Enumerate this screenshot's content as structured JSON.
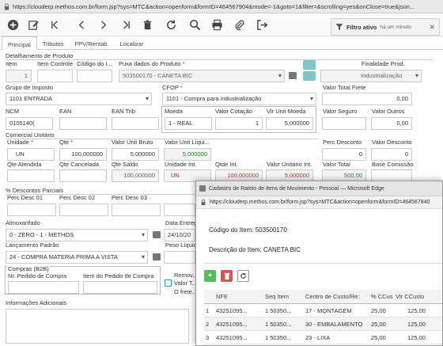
{
  "browser": {
    "url": "https://clouderp.methos.com.br/form.jsp?sys=MTC&action=openform&formID=464567904&mode=-1&goto=1&filter=&scrolling=yes&onClose=true&json..."
  },
  "toolbar": {
    "icons": [
      "add-icon",
      "edit-icon",
      "back-icon",
      "prev-icon",
      "next-icon",
      "forward-icon",
      "delete-icon",
      "refresh-icon",
      "search-icon",
      "print-icon",
      "attach-icon",
      "exit-icon"
    ],
    "filter_label": "Filtro ativo",
    "filter_time": "há um minuto"
  },
  "tabs": [
    "Principal",
    "Tributos",
    "FPV/Rentab.",
    "Localizar"
  ],
  "form": {
    "section_detalhamento": "Detalhamento de Produto",
    "item_label": "Item",
    "item_value": "1",
    "item_controle_label": "Item Controle",
    "codigo_label": "Código do I...",
    "puxa_label": "Puxa dados do Produto",
    "puxa_value": "503500170 - CANETA BIC",
    "finalidade_label": "Finalidade Prod.",
    "finalidade_value": "Industrialização",
    "grupo_imposto_label": "Grupo de Imposto",
    "grupo_imposto_value": "1101 ENTRADA",
    "cfop_label": "CFOP",
    "cfop_value": "1101 - Compra para industrialização",
    "valor_total_frete_label": "Valor Total Frete",
    "valor_total_frete_value": "0,00",
    "ncm_label": "NCM",
    "ncm_value": "0105140(",
    "ean_label": "EAN",
    "ean_trib_label": "EAN Trib",
    "moeda_label": "Moeda",
    "moeda_value": "1 - REAL",
    "valor_cotacao_label": "Valor Cotação",
    "valor_cotacao_value": "1",
    "vlr_unit_moeda_label": "Vlr Unit Moeda",
    "vlr_unit_moeda_value": "5,000000",
    "valor_seguro_label": "Valor Seguro",
    "valor_outros_label": "Valor Outros",
    "valor_outros_value": "0,00",
    "section_comercial": "Comercial Unitário",
    "unidade_label": "Unidade",
    "unidade_value": "UN",
    "qte_label": "Qte",
    "qte_value": "100,000000",
    "valor_unit_bruto_label": "Valor Unit Bruto",
    "valor_unit_bruto_value": "5,000000",
    "valor_unit_liquido_label": "Valor Unit Líqui...",
    "valor_unit_liquido_value": "5,000000",
    "perc_desconto_label": "Perc Desconto",
    "perc_desconto_value": "0",
    "valor_desconto_label": "Valor Desconto",
    "valor_desconto_value": "0",
    "qte_atendida_label": "Qte Atendida",
    "qte_cancelada_label": "Qte Cancelada",
    "qte_saldo_label": "Qte Saldo",
    "qte_saldo_value": "100,000000",
    "unidade_int_label": "Unidade Int.",
    "unidade_int_value": "UN",
    "qtde_int_label": "Qtde Int.",
    "qtde_int_value": "100,000000",
    "valor_unitario_int_label": "Valor Unitario Int.",
    "valor_unitario_int_value": "5,000000",
    "valor_total_label": "Valor Total",
    "valor_total_value": "500,00",
    "base_comissao_label": "Base Comissão",
    "section_desc_parciais": "% Descontos Parciais",
    "perc_desc_01_label": "Perc Desc 01",
    "perc_desc_02_label": "Perc Desc 02",
    "perc_desc_03_label": "Perc Desc 03",
    "almoxarifado_label": "Almoxarifado",
    "almoxarifado_value": "0 - ZERO - 1 - METHOS",
    "data_entrega_label": "Data Entreg...",
    "data_entrega_value": "24/10/20",
    "lancamento_label": "Lançamento Padrão",
    "lancamento_value": "24 - COMPRA MATERIA PRIMA A VISTA",
    "peso_liquido_label": "Peso Líquid...",
    "section_compras": "Compras (B2B)",
    "nr_pedido_label": "Nr. Pedido de Compra",
    "item_pedido_label": "Item do Pedido de Compra",
    "remover_label": "Remov...",
    "valor_t_label": "Valor T...",
    "frete_label": "O frete...",
    "info_adicionais_label": "Informações Adicionais"
  },
  "popup": {
    "title": "Cadastro de Rateio de Itens de Movimento - Pessoal — Microsoft Edge",
    "url": "https://clouderp.methos.com.br/form.jsp?sys=MTC&action=openform&formID=464567840",
    "codigo_label": "Código do Item:",
    "codigo_value": "503500170",
    "descricao_label": "Descrição do Item:",
    "descricao_value": "CANETA BIC",
    "columns": [
      "NFE",
      "Seq Item",
      "Centro de Custo/Re:",
      "% CCus",
      "Vlr CCusto"
    ],
    "rows": [
      {
        "n": "1",
        "nfe": "43251095...",
        "seq": "1 50350...",
        "centro": "17 - MONTAGEM",
        "perc": "25,00",
        "vlr": "125,00"
      },
      {
        "n": "2",
        "nfe": "43251095...",
        "seq": "1 50350...",
        "centro": "30 - EMBALAMENTO",
        "perc": "25,00",
        "vlr": "125,00"
      },
      {
        "n": "3",
        "nfe": "43251095...",
        "seq": "1 50350...",
        "centro": "23 - LIXA",
        "perc": "25,00",
        "vlr": "125,00"
      }
    ]
  },
  "colors": {
    "accent_green": "#5cb85c",
    "accent_red": "#d9534f",
    "teal": "#7fc6c6",
    "red_text": "#c0392b",
    "green_text": "#2e7d32"
  }
}
